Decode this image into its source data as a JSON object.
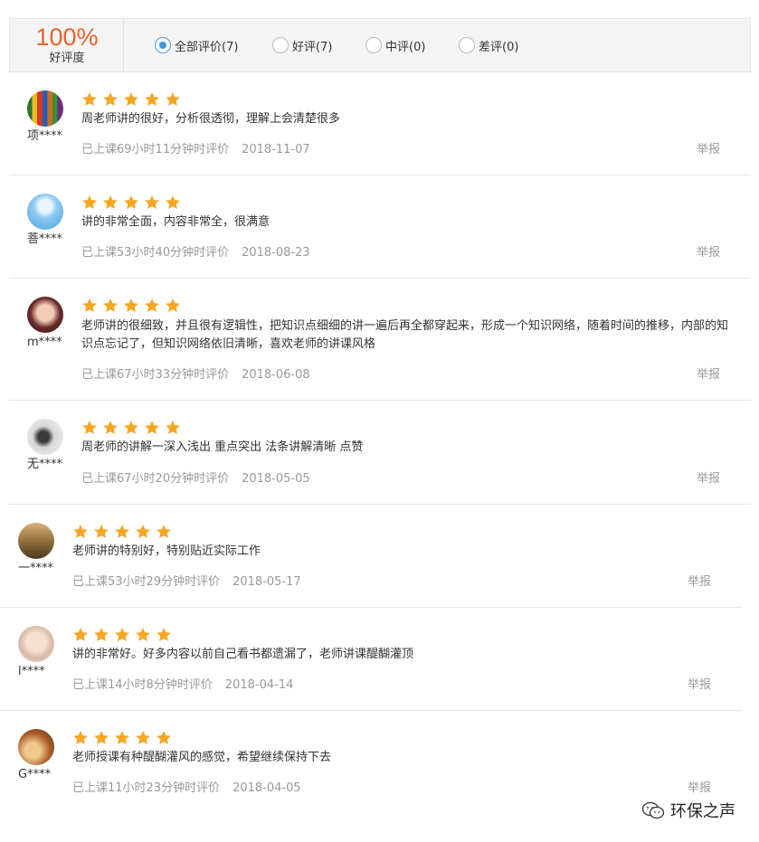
{
  "summary": {
    "percent": "100%",
    "label": "好评度",
    "filters": [
      {
        "label": "全部评价(7)",
        "checked": true
      },
      {
        "label": "好评(7)",
        "checked": false
      },
      {
        "label": "中评(0)",
        "checked": false
      },
      {
        "label": "差评(0)",
        "checked": false
      }
    ]
  },
  "star_color": "#f5a623",
  "reviews": [
    {
      "user": "项****",
      "rating": 5,
      "content": "周老师讲的很好，分析很透彻，理解上会清楚很多",
      "study": "已上课69小时11分钟时评价",
      "date": "2018-11-07",
      "report": "举报"
    },
    {
      "user": "菩****",
      "rating": 5,
      "content": "讲的非常全面，内容非常全，很满意",
      "study": "已上课53小时40分钟时评价",
      "date": "2018-08-23",
      "report": "举报"
    },
    {
      "user": "m****",
      "rating": 5,
      "content": "老师讲的很细致，并且很有逻辑性，把知识点细细的讲一遍后再全都穿起来，形成一个知识网络，随着时间的推移，内部的知识点忘记了，但知识网络依旧清晰，喜欢老师的讲课风格",
      "study": "已上课67小时33分钟时评价",
      "date": "2018-06-08",
      "report": "举报"
    },
    {
      "user": "无****",
      "rating": 5,
      "content": "周老师的讲解一深入浅出 重点突出 法条讲解清晰 点赞",
      "study": "已上课67小时20分钟时评价",
      "date": "2018-05-05",
      "report": "举报"
    },
    {
      "user": "一****",
      "rating": 5,
      "content": "老师讲的特别好，特别贴近实际工作",
      "study": "已上课53小时29分钟时评价",
      "date": "2018-05-17",
      "report": "举报"
    },
    {
      "user": "l****",
      "rating": 5,
      "content": "讲的非常好。好多内容以前自己看书都遗漏了，老师讲课醍醐灌顶",
      "study": "已上课14小时8分钟时评价",
      "date": "2018-04-14",
      "report": "举报"
    },
    {
      "user": "G****",
      "rating": 5,
      "content": "老师授课有种醍醐灌风的感觉，希望继续保持下去",
      "study": "已上课11小时23分钟时评价",
      "date": "2018-04-05",
      "report": "举报"
    }
  ],
  "watermark": {
    "text": "环保之声",
    "icon": "wechat-icon"
  }
}
